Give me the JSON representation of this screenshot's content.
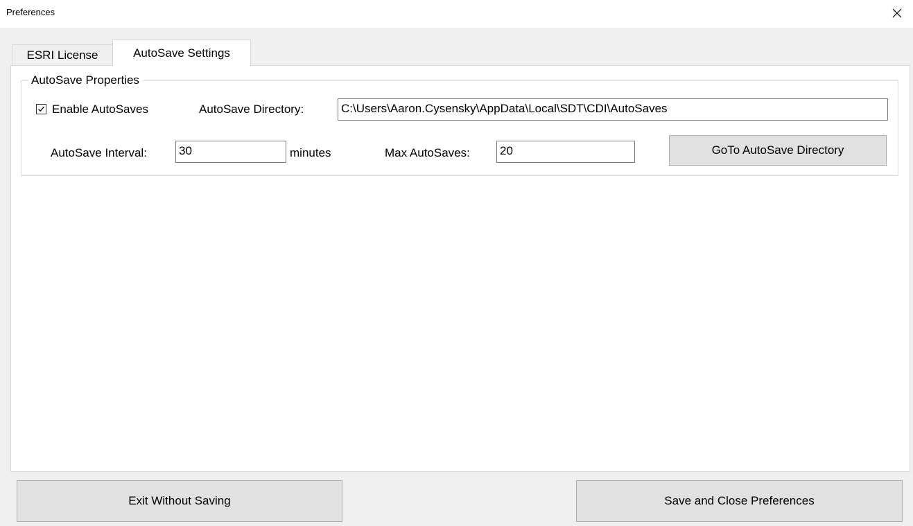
{
  "window": {
    "title": "Preferences",
    "close_icon": "close-icon"
  },
  "tabs": [
    {
      "label": "ESRI License",
      "active": false
    },
    {
      "label": "AutoSave Settings",
      "active": true
    }
  ],
  "autosave": {
    "group_title": "AutoSave Properties",
    "enable_label": "Enable AutoSaves",
    "enable_checked": true,
    "directory_label": "AutoSave Directory:",
    "directory_value": "C:\\Users\\Aaron.Cysensky\\AppData\\Local\\SDT\\CDI\\AutoSaves",
    "interval_label": "AutoSave Interval:",
    "interval_value": "30",
    "interval_unit": "minutes",
    "max_label": "Max AutoSaves:",
    "max_value": "20",
    "goto_button": "GoTo AutoSave Directory"
  },
  "footer": {
    "exit_button": "Exit Without Saving",
    "save_button": "Save and Close Preferences"
  }
}
